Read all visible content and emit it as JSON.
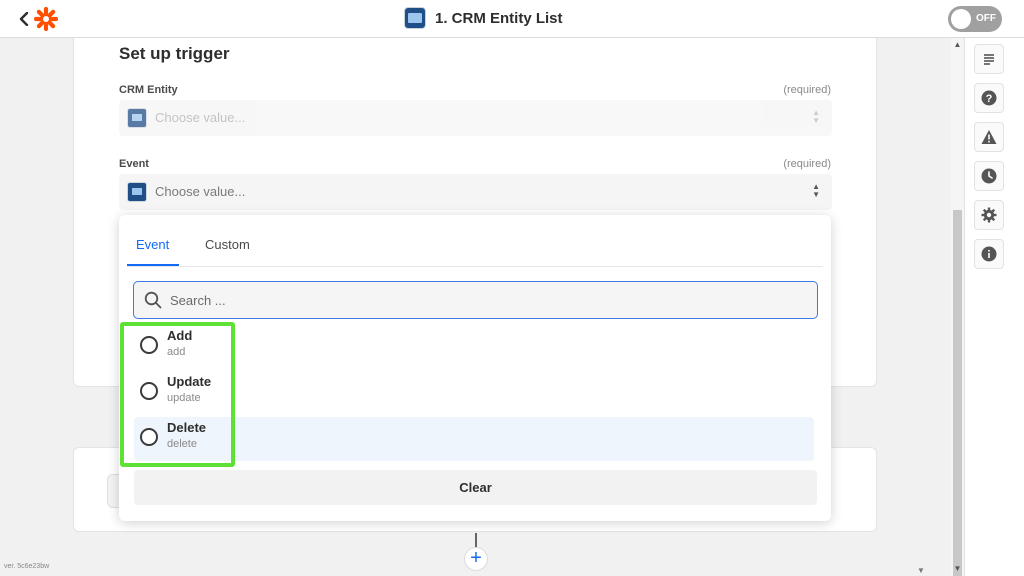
{
  "header": {
    "title": "1. CRM Entity List",
    "toggle_label": "OFF"
  },
  "setup": {
    "title": "Set up trigger",
    "fields": [
      {
        "label": "CRM Entity",
        "required": "(required)",
        "placeholder": "Choose value..."
      },
      {
        "label": "Event",
        "required": "(required)",
        "placeholder": "Choose value..."
      }
    ]
  },
  "dropdown": {
    "tabs": [
      "Event",
      "Custom"
    ],
    "active_tab": "Event",
    "search_placeholder": "Search ...",
    "options": [
      {
        "label": "Add",
        "value": "add"
      },
      {
        "label": "Update",
        "value": "update"
      },
      {
        "label": "Delete",
        "value": "delete"
      }
    ],
    "clear_label": "Clear"
  },
  "rail": {
    "icons": [
      "details-icon",
      "help-icon",
      "warning-icon",
      "history-icon",
      "settings-icon",
      "info-icon"
    ]
  },
  "footer": {
    "version": "ver. 5c6e23bw",
    "add_label": "+"
  },
  "colors": {
    "accent": "#136bf5",
    "brand": "#ff4f00",
    "highlight": "#5ee135"
  }
}
